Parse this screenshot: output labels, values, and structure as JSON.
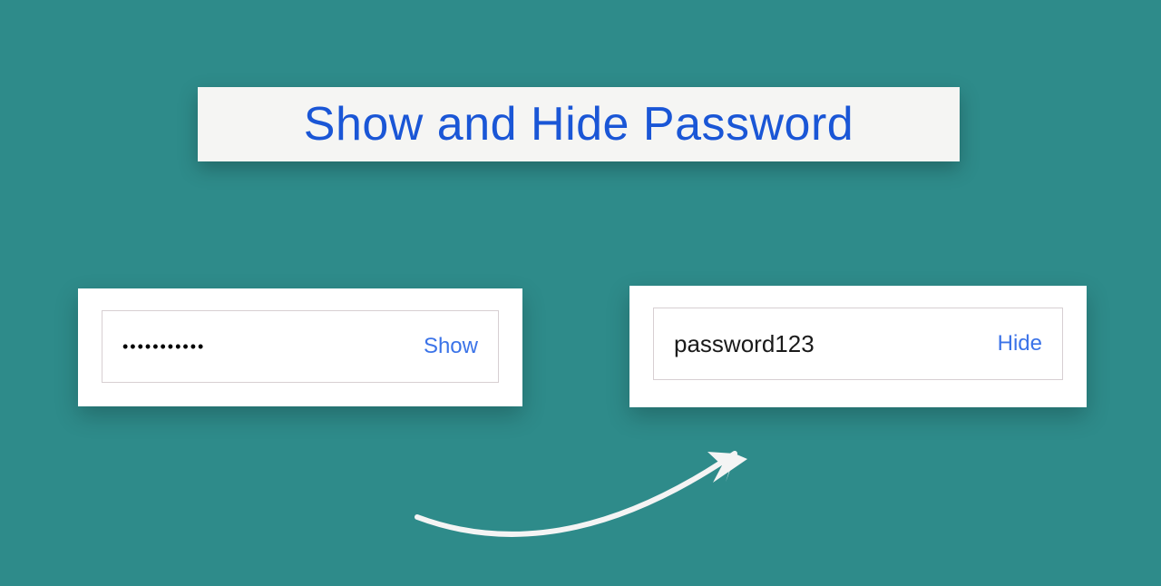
{
  "title": "Show and Hide Password",
  "left_card": {
    "masked_value": "•••••••••••",
    "toggle_label": "Show"
  },
  "right_card": {
    "revealed_value": "password123",
    "toggle_label": "Hide"
  }
}
